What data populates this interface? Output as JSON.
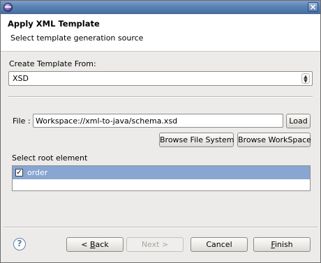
{
  "window": {
    "close_glyph": "×"
  },
  "banner": {
    "title": "Apply XML Template",
    "subtitle": "Select template generation source"
  },
  "form": {
    "create_label": "Create Template From:",
    "source_selected": "XSD",
    "file_label": "File :",
    "file_value": "Workspace://xml-to-java/schema.xsd",
    "load_label": "Load",
    "browse_fs_label": "Browse File System",
    "browse_ws_label": "Browse WorkSpace",
    "root_label": "Select root element",
    "root_items": [
      {
        "label": "order",
        "checked": true,
        "check_glyph": "✓"
      }
    ]
  },
  "footer": {
    "help_glyph": "?",
    "back_mnemonic": "B",
    "back_rest": "ack",
    "back_prefix": "< ",
    "next_label": "Next >",
    "cancel_label": "Cancel",
    "finish_mnemonic": "F",
    "finish_rest": "inish"
  },
  "colors": {
    "selection": "#88a6d1",
    "titlebar": "#5c82b3"
  }
}
